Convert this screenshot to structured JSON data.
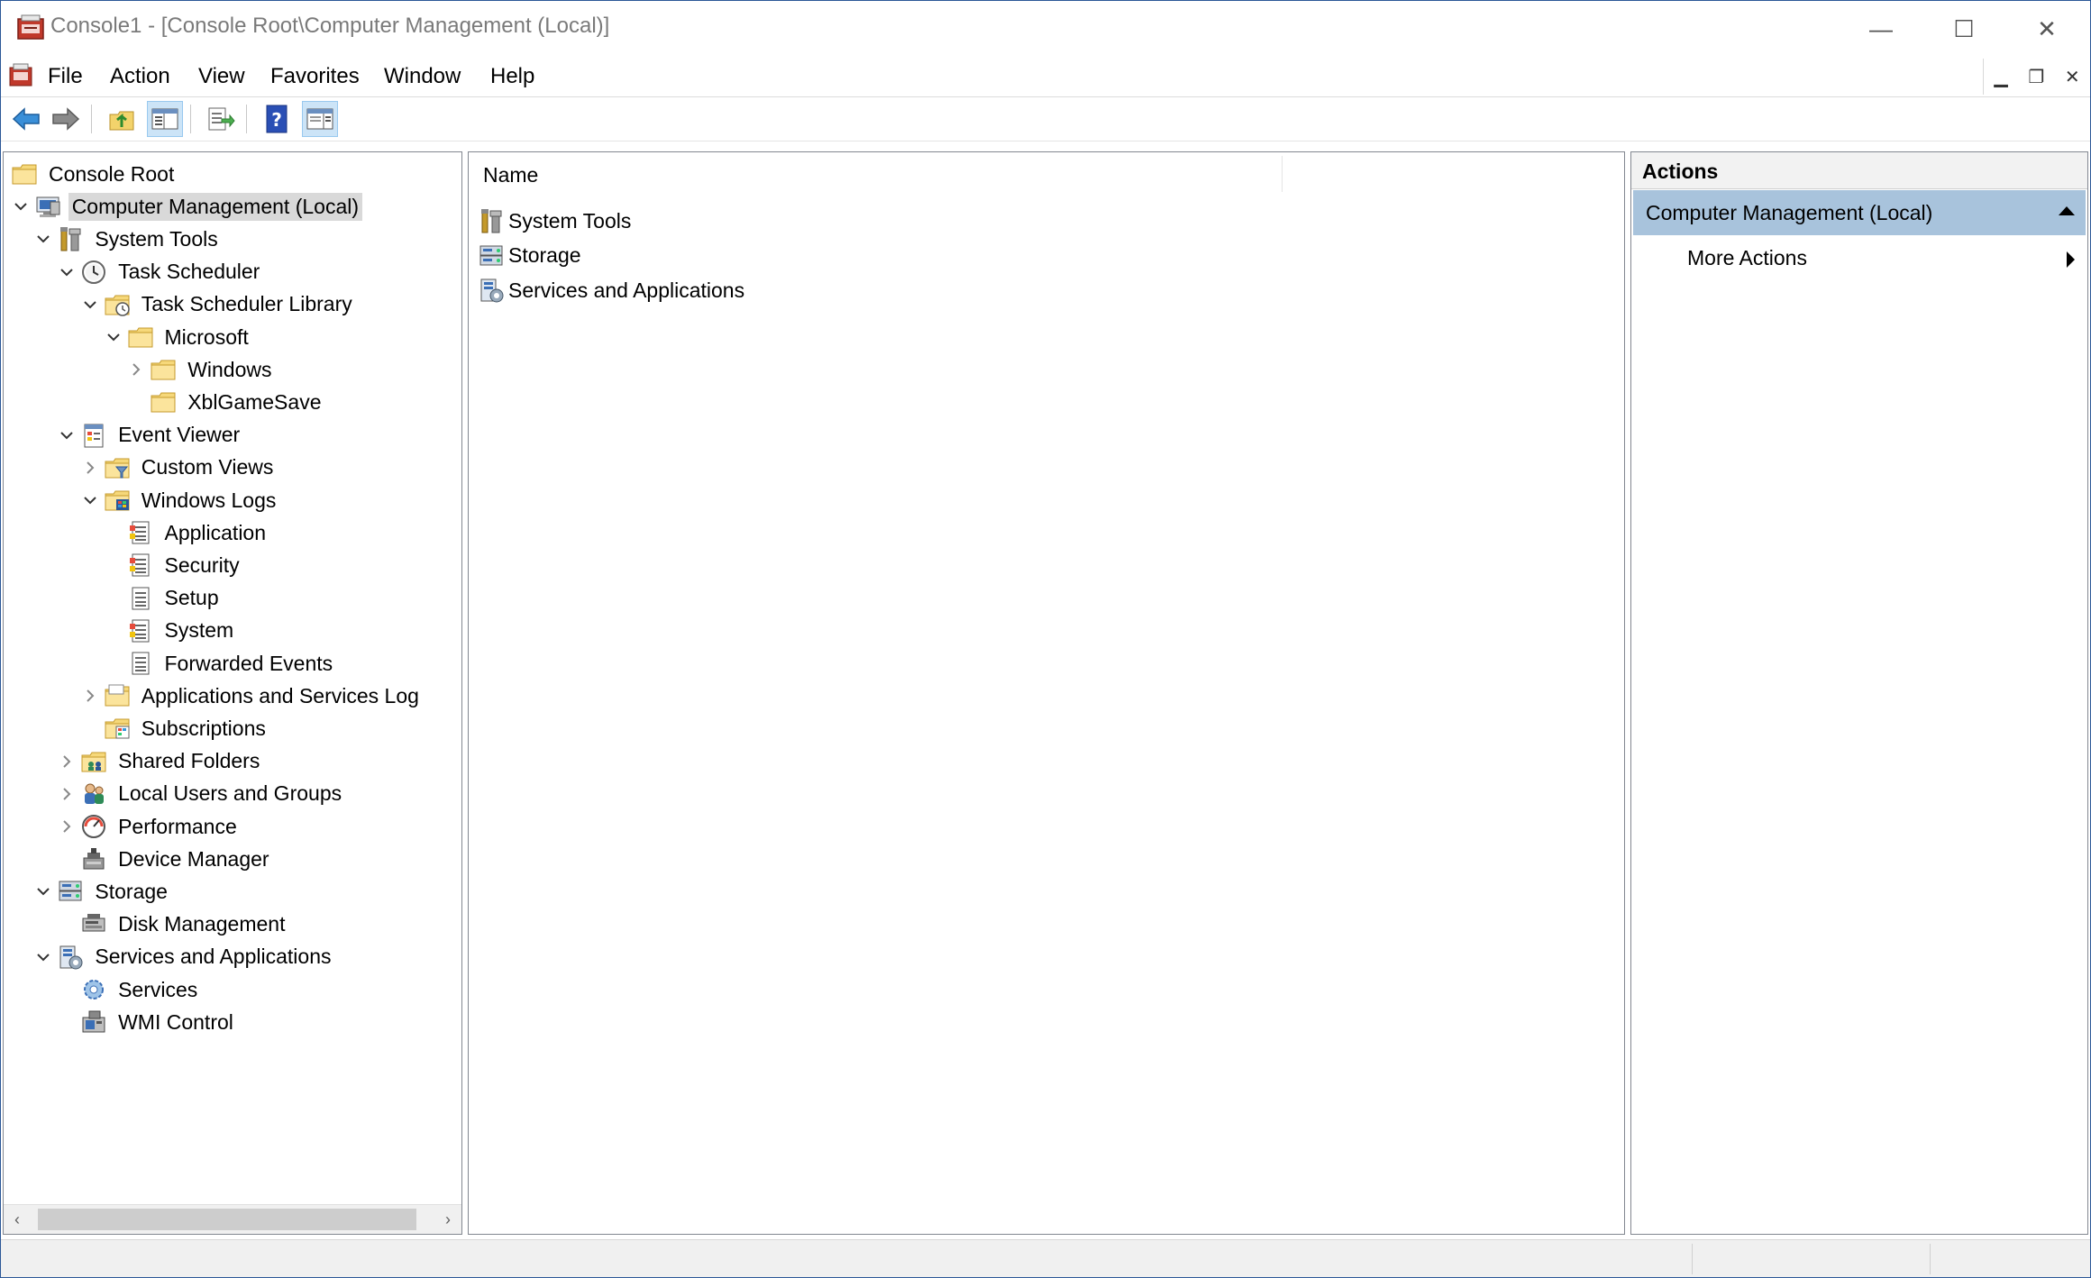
{
  "window": {
    "title": "Console1 - [Console Root\\Computer Management (Local)]",
    "caption": {
      "minimize": "—",
      "maximize": "☐",
      "close": "✕"
    }
  },
  "menu": {
    "items": [
      "File",
      "Action",
      "View",
      "Favorites",
      "Window",
      "Help"
    ],
    "mdi": {
      "minimize": "▁",
      "restore": "❐",
      "close": "✕"
    }
  },
  "toolbar": {
    "buttons": [
      {
        "icon": "back-arrow-icon"
      },
      {
        "icon": "forward-arrow-icon"
      },
      {
        "icon": "up-one-level-icon"
      },
      {
        "icon": "show-hide-console-tree-icon"
      },
      {
        "icon": "export-list-icon"
      },
      {
        "icon": "help-icon",
        "glyph": "?"
      },
      {
        "icon": "show-hide-action-pane-icon"
      }
    ]
  },
  "tree": {
    "nodes": [
      {
        "label": "Console Root",
        "level": 0,
        "expander": "none",
        "icon": "folder"
      },
      {
        "label": "Computer Management (Local)",
        "level": 1,
        "expander": "expanded",
        "icon": "computer-management",
        "selected": true
      },
      {
        "label": "System Tools",
        "level": 2,
        "expander": "expanded",
        "icon": "system-tools"
      },
      {
        "label": "Task Scheduler",
        "level": 3,
        "expander": "expanded",
        "icon": "clock"
      },
      {
        "label": "Task Scheduler Library",
        "level": 4,
        "expander": "expanded",
        "icon": "folder-clock"
      },
      {
        "label": "Microsoft",
        "level": 5,
        "expander": "expanded",
        "icon": "folder"
      },
      {
        "label": "Windows",
        "level": 6,
        "expander": "collapsed",
        "icon": "folder"
      },
      {
        "label": "XblGameSave",
        "level": 6,
        "expander": "none",
        "icon": "folder"
      },
      {
        "label": "Event Viewer",
        "level": 3,
        "expander": "expanded",
        "icon": "event-viewer"
      },
      {
        "label": "Custom Views",
        "level": 4,
        "expander": "collapsed",
        "icon": "folder-filter"
      },
      {
        "label": "Windows Logs",
        "level": 4,
        "expander": "expanded",
        "icon": "folder-windows"
      },
      {
        "label": "Application",
        "level": 5,
        "expander": "none",
        "icon": "log"
      },
      {
        "label": "Security",
        "level": 5,
        "expander": "none",
        "icon": "log"
      },
      {
        "label": "Setup",
        "level": 5,
        "expander": "none",
        "icon": "log-plain"
      },
      {
        "label": "System",
        "level": 5,
        "expander": "none",
        "icon": "log"
      },
      {
        "label": "Forwarded Events",
        "level": 5,
        "expander": "none",
        "icon": "log-plain"
      },
      {
        "label": "Applications and Services Log",
        "level": 4,
        "expander": "collapsed",
        "icon": "folder-open"
      },
      {
        "label": "Subscriptions",
        "level": 4,
        "expander": "none",
        "icon": "subscriptions"
      },
      {
        "label": "Shared Folders",
        "level": 3,
        "expander": "collapsed",
        "icon": "shared-folders"
      },
      {
        "label": "Local Users and Groups",
        "level": 3,
        "expander": "collapsed",
        "icon": "users"
      },
      {
        "label": "Performance",
        "level": 3,
        "expander": "collapsed",
        "icon": "performance"
      },
      {
        "label": "Device Manager",
        "level": 3,
        "expander": "none",
        "icon": "device-manager"
      },
      {
        "label": "Storage",
        "level": 2,
        "expander": "expanded",
        "icon": "storage"
      },
      {
        "label": "Disk Management",
        "level": 3,
        "expander": "none",
        "icon": "disk"
      },
      {
        "label": "Services and Applications",
        "level": 2,
        "expander": "expanded",
        "icon": "services-apps"
      },
      {
        "label": "Services",
        "level": 3,
        "expander": "none",
        "icon": "gear"
      },
      {
        "label": "WMI Control",
        "level": 3,
        "expander": "none",
        "icon": "wmi"
      }
    ],
    "scroll": {
      "left_arrow": "‹",
      "right_arrow": "›"
    }
  },
  "list": {
    "column_header": "Name",
    "items": [
      {
        "label": "System Tools",
        "icon": "system-tools"
      },
      {
        "label": "Storage",
        "icon": "storage"
      },
      {
        "label": "Services and Applications",
        "icon": "services-apps"
      }
    ]
  },
  "actions": {
    "header": "Actions",
    "section_title": "Computer Management (Local)",
    "items": [
      "More Actions"
    ]
  },
  "colors": {
    "selection": "#d9d9d9",
    "actions_section": "#a8c3dc",
    "toolbar_pressed": "#cce4f7",
    "window_border": "#2b5797"
  }
}
